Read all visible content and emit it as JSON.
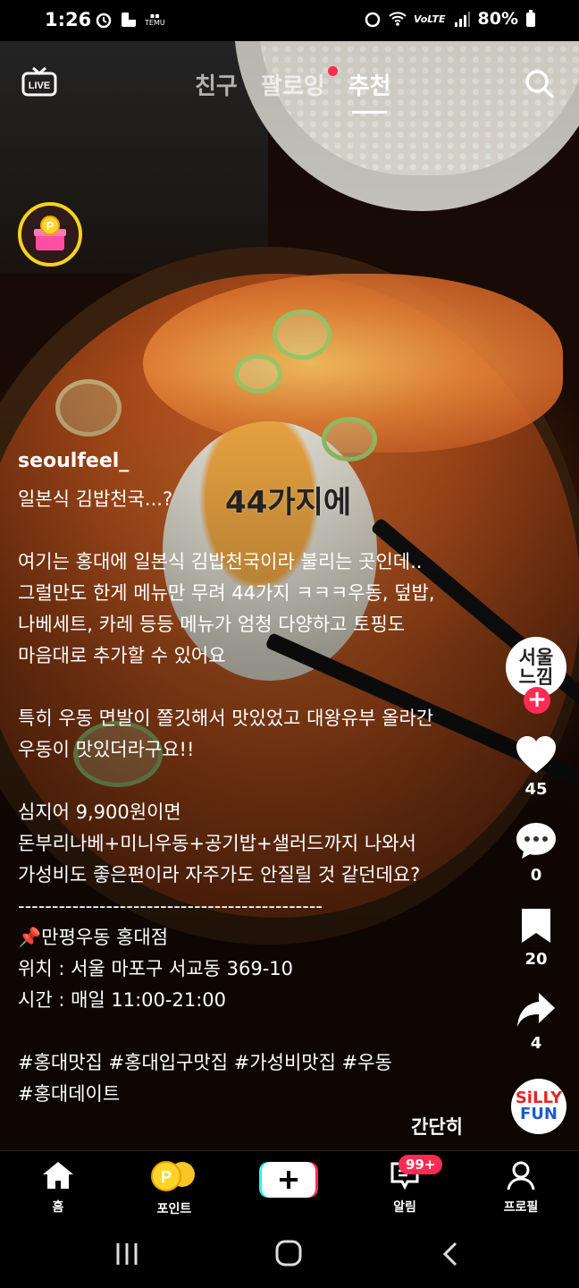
{
  "status_bar": {
    "time": "1:26",
    "battery": "80%",
    "carrier_label": "VoLTE",
    "temu_label": "TEMU"
  },
  "top_nav": {
    "tabs": [
      {
        "label": "친구"
      },
      {
        "label": "팔로잉"
      },
      {
        "label": "추천"
      }
    ],
    "active_tab": "추천",
    "live_label": "LIVE"
  },
  "video": {
    "overlay_text": "44가지에"
  },
  "post": {
    "username": "seoulfeel_",
    "caption_lines": [
      "일본식 김밥천국...?",
      "",
      "여기는 홍대에 일본식 김밥천국이라 불리는 곳인데..",
      "그럴만도 한게 메뉴만 무려 44가지 ㅋㅋㅋ우동, 덮밥,",
      "나베세트, 카레 등등 메뉴가 엄청 다양하고 토핑도",
      "마음대로 추가할 수 있어요",
      "",
      "특히 우동 면발이 쫄깃해서 맛있었고 대왕유부 올라간",
      "우동이 맛있더라구요!!",
      "",
      "심지어 9,900원이면",
      "돈부리나베+미니우동+공기밥+샐러드까지 나와서",
      "가성비도 좋은편이라 자주가도 안질릴 것 같던데요?",
      "---------------------------------------------",
      "📌만평우동 홍대점",
      "위치 : 서울 마포구 서교동 369-10",
      "시간 : 매일 11:00-21:00",
      "",
      "#홍대맛집 #홍대입구맛집 #가성비맛집 #우동",
      "#홍대데이트"
    ],
    "summary_label": "간단히"
  },
  "right_rail": {
    "avatar_text_line1": "서울",
    "avatar_text_line2": "느낌",
    "likes": "45",
    "comments": "0",
    "saves": "20",
    "shares": "4",
    "music_line1": "SiLLY",
    "music_line2": "FUN"
  },
  "bottom_nav": {
    "items": [
      {
        "label": "홈",
        "icon": "home-icon"
      },
      {
        "label": "포인트",
        "icon": "coin-icon"
      },
      {
        "label": "",
        "icon": "plus-icon"
      },
      {
        "label": "알림",
        "icon": "inbox-icon"
      },
      {
        "label": "프로필",
        "icon": "profile-icon"
      }
    ],
    "inbox_badge": "99+"
  },
  "colors": {
    "accent": "#fe2c55",
    "coin": "#f7d21c"
  }
}
